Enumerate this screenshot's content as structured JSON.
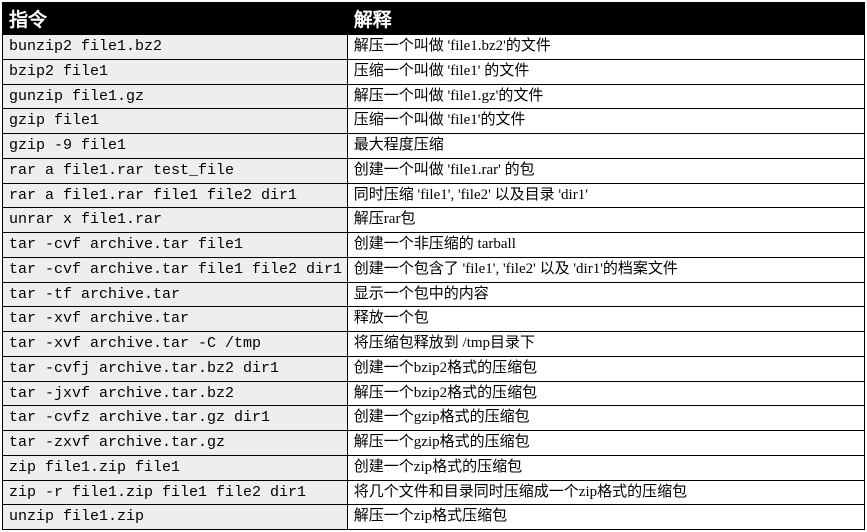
{
  "headers": {
    "command": "指令",
    "explain": "解释"
  },
  "rows": [
    {
      "cmd": "bunzip2 file1.bz2",
      "desc": "解压一个叫做 'file1.bz2'的文件"
    },
    {
      "cmd": "bzip2 file1",
      "desc": "压缩一个叫做 'file1' 的文件"
    },
    {
      "cmd": "gunzip file1.gz",
      "desc": "解压一个叫做 'file1.gz'的文件"
    },
    {
      "cmd": "gzip file1",
      "desc": "压缩一个叫做 'file1'的文件"
    },
    {
      "cmd": "gzip -9 file1",
      "desc": "最大程度压缩"
    },
    {
      "cmd": "rar a file1.rar test_file",
      "desc": "创建一个叫做 'file1.rar' 的包"
    },
    {
      "cmd": "rar a file1.rar file1 file2 dir1",
      "desc": "同时压缩 'file1', 'file2' 以及目录 'dir1'"
    },
    {
      "cmd": "unrar x file1.rar",
      "desc": "解压rar包"
    },
    {
      "cmd": "tar -cvf archive.tar file1",
      "desc": "创建一个非压缩的 tarball"
    },
    {
      "cmd": "tar -cvf archive.tar file1 file2 dir1",
      "desc": "创建一个包含了 'file1', 'file2' 以及 'dir1'的档案文件"
    },
    {
      "cmd": "tar -tf archive.tar",
      "desc": "显示一个包中的内容"
    },
    {
      "cmd": "tar -xvf archive.tar",
      "desc": "释放一个包"
    },
    {
      "cmd": "tar -xvf archive.tar -C /tmp",
      "desc": "将压缩包释放到 /tmp目录下"
    },
    {
      "cmd": "tar -cvfj archive.tar.bz2 dir1",
      "desc": "创建一个bzip2格式的压缩包"
    },
    {
      "cmd": "tar -jxvf archive.tar.bz2",
      "desc": "解压一个bzip2格式的压缩包"
    },
    {
      "cmd": "tar -cvfz archive.tar.gz dir1",
      "desc": "创建一个gzip格式的压缩包"
    },
    {
      "cmd": "tar -zxvf archive.tar.gz",
      "desc": "解压一个gzip格式的压缩包"
    },
    {
      "cmd": "zip file1.zip file1",
      "desc": "创建一个zip格式的压缩包"
    },
    {
      "cmd": "zip -r file1.zip file1 file2 dir1",
      "desc": "将几个文件和目录同时压缩成一个zip格式的压缩包"
    },
    {
      "cmd": "unzip file1.zip",
      "desc": "解压一个zip格式压缩包"
    }
  ]
}
